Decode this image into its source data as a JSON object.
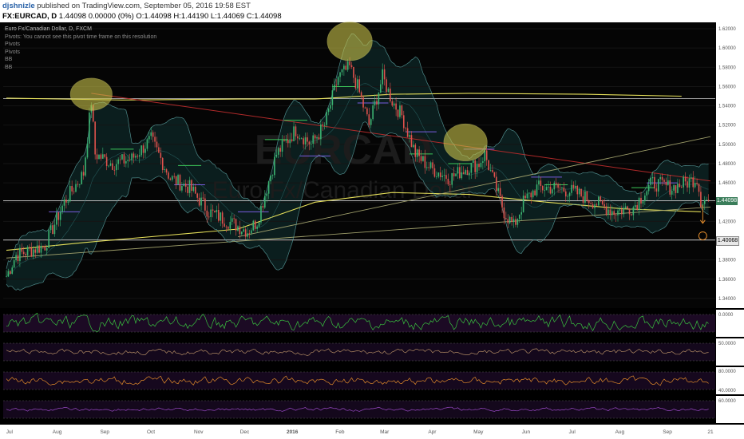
{
  "header": {
    "user": "djshnizle",
    "published": " published on TradingView.com, September 05, 2016 19:58 EST",
    "symbol_line": "FX:EURCAD, D",
    "ohlc": " 1.44098 0.00000 (0%) O:1.44098 H:1.44190 L:1.44069 C:1.44098"
  },
  "legend": {
    "title": "Euro Fx/Canadian Dollar, D, FXCM",
    "lines": [
      "Pivots: You cannot see this pivot time frame on this resolution",
      "Pivots",
      "Pivots",
      "BB",
      "BB"
    ]
  },
  "watermark": {
    "symbol": "EURCAD",
    "name": "Euro Fx/Canadian Dollar"
  },
  "price_tags": {
    "last": {
      "label": "1.44098",
      "value": 1.44098,
      "color": "#3a7d5a"
    },
    "level": {
      "label": "1.40068",
      "value": 1.40068,
      "color": "#e8e8e8"
    }
  },
  "colors": {
    "up": "#3cb371",
    "down": "#e0524d",
    "bb": "#5fa7a7",
    "sma": "#e6e05a",
    "trend_red": "#b02a2a",
    "pivot_green": "#3cc85a",
    "pivot_purple": "#7a5ce0",
    "highlight": "#c9c24a",
    "rsi1": "#39c23f",
    "rsi2": "#b08a63",
    "rsi3": "#e08a2a",
    "rsi4": "#9b4ac8"
  },
  "chart_data": {
    "type": "candlestick",
    "title": "Euro Fx/Canadian Dollar, D, FXCM",
    "ylim": [
      1.33,
      1.625
    ],
    "y_ticks": [
      "1.62000",
      "1.60000",
      "1.58000",
      "1.56000",
      "1.54000",
      "1.52000",
      "1.50000",
      "1.48000",
      "1.46000",
      "1.44000",
      "1.42000",
      "1.40000",
      "1.38000",
      "1.36000",
      "1.34000"
    ],
    "x_ticks": [
      "Jul",
      "Aug",
      "Sep",
      "Oct",
      "Nov",
      "Dec",
      "2016",
      "Feb",
      "Mar",
      "Apr",
      "May",
      "Jun",
      "Jul",
      "Aug",
      "Sep",
      "21"
    ],
    "anchors": [
      [
        0,
        1.363
      ],
      [
        5,
        1.385
      ],
      [
        20,
        1.395
      ],
      [
        30,
        1.44
      ],
      [
        40,
        1.47
      ],
      [
        44,
        1.545
      ],
      [
        46,
        1.49
      ],
      [
        55,
        1.48
      ],
      [
        65,
        1.485
      ],
      [
        75,
        1.505
      ],
      [
        85,
        1.465
      ],
      [
        95,
        1.455
      ],
      [
        105,
        1.43
      ],
      [
        115,
        1.42
      ],
      [
        125,
        1.41
      ],
      [
        130,
        1.42
      ],
      [
        140,
        1.49
      ],
      [
        150,
        1.515
      ],
      [
        158,
        1.5
      ],
      [
        165,
        1.52
      ],
      [
        172,
        1.57
      ],
      [
        178,
        1.58
      ],
      [
        182,
        1.56
      ],
      [
        188,
        1.52
      ],
      [
        195,
        1.57
      ],
      [
        200,
        1.545
      ],
      [
        205,
        1.53
      ],
      [
        212,
        1.49
      ],
      [
        220,
        1.475
      ],
      [
        230,
        1.465
      ],
      [
        238,
        1.475
      ],
      [
        245,
        1.48
      ],
      [
        248,
        1.49
      ],
      [
        252,
        1.465
      ],
      [
        258,
        1.43
      ],
      [
        263,
        1.415
      ],
      [
        268,
        1.44
      ],
      [
        275,
        1.455
      ],
      [
        285,
        1.455
      ],
      [
        295,
        1.45
      ],
      [
        305,
        1.44
      ],
      [
        315,
        1.43
      ],
      [
        325,
        1.435
      ],
      [
        335,
        1.46
      ],
      [
        345,
        1.455
      ],
      [
        352,
        1.46
      ],
      [
        358,
        1.465
      ],
      [
        360,
        1.442
      ]
    ],
    "oscillators": [
      {
        "name": "",
        "ref_label": "0.0000"
      },
      {
        "name": "",
        "ref_label": "50.0000"
      },
      {
        "name": "",
        "top_label": "80.0000",
        "bottom_label": "40.0000"
      },
      {
        "name": "",
        "ref_label": "60.0000"
      }
    ]
  }
}
